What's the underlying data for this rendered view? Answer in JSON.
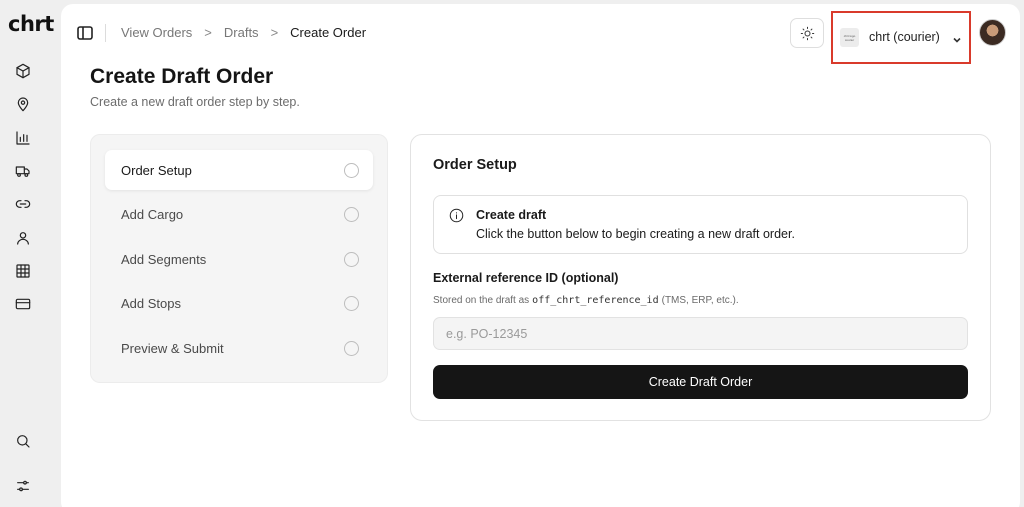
{
  "app": {
    "logo_text": "chrt"
  },
  "rail": {
    "items": [
      {
        "icon": "package-icon"
      },
      {
        "icon": "map-pin-icon"
      },
      {
        "icon": "bar-chart-icon"
      },
      {
        "icon": "truck-icon"
      },
      {
        "icon": "link-icon"
      },
      {
        "icon": "user-icon"
      },
      {
        "icon": "table-icon"
      },
      {
        "icon": "credit-card-icon"
      }
    ],
    "bottom_items": [
      {
        "icon": "search-icon"
      },
      {
        "icon": "sliders-icon"
      }
    ]
  },
  "breadcrumb": {
    "items": [
      "View Orders",
      "Drafts",
      "Create Order"
    ],
    "separator": ">"
  },
  "header": {
    "org_name": "chrt (courier)",
    "org_avatar_text": "chrt logo courier"
  },
  "page": {
    "title": "Create Draft Order",
    "subtitle": "Create a new draft order step by step."
  },
  "steps": {
    "items": [
      {
        "label": "Order Setup",
        "active": true
      },
      {
        "label": "Add Cargo",
        "active": false
      },
      {
        "label": "Add Segments",
        "active": false
      },
      {
        "label": "Add Stops",
        "active": false
      },
      {
        "label": "Preview & Submit",
        "active": false
      }
    ]
  },
  "card": {
    "title": "Order Setup",
    "info": {
      "title": "Create draft",
      "text": "Click the button below to begin creating a new draft order."
    },
    "field": {
      "label": "External reference ID (optional)",
      "help_prefix": "Stored on the draft as",
      "help_code": "off_chrt_reference_id",
      "help_suffix": "(TMS, ERP, etc.).",
      "placeholder": "e.g. PO-12345",
      "value": ""
    },
    "submit_label": "Create Draft Order"
  },
  "colors": {
    "highlight": "#d93a2b",
    "primary_button": "#151515"
  }
}
